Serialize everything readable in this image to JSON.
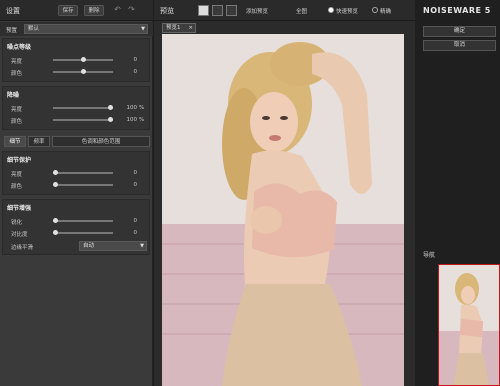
{
  "left_panel": {
    "title": "设置",
    "save_label": "保存",
    "delete_label": "删除",
    "undo_icon": "undo-icon",
    "redo_icon": "redo-icon",
    "preset": {
      "label": "预置",
      "value": "默认"
    },
    "noise_level": {
      "title": "噪点等级",
      "rows": [
        {
          "label": "亮度",
          "value": "0",
          "level": 0.5
        },
        {
          "label": "颜色",
          "value": "0",
          "level": 0.5
        }
      ]
    },
    "noise_reduction": {
      "title": "降噪",
      "rows": [
        {
          "label": "亮度",
          "value": "100",
          "unit": "%",
          "level": 1.0
        },
        {
          "label": "颜色",
          "value": "100",
          "unit": "%",
          "level": 1.0
        }
      ]
    },
    "tabs": [
      {
        "label": "细节",
        "active": true
      },
      {
        "label": "频率",
        "active": false
      },
      {
        "label": "色调和颜色范围",
        "active": false
      }
    ],
    "detail_protection": {
      "title": "细节保护",
      "rows": [
        {
          "label": "亮度",
          "value": "0",
          "level": 0.0
        },
        {
          "label": "颜色",
          "value": "0",
          "level": 0.0
        }
      ]
    },
    "detail_enhance": {
      "title": "细节增强",
      "rows": [
        {
          "label": "锐化",
          "value": "0",
          "level": 0.0
        },
        {
          "label": "对比度",
          "value": "0",
          "level": 0.0
        }
      ],
      "edge_label": "边缘平滑",
      "edge_value": "自动"
    }
  },
  "center": {
    "title": "预览",
    "add_label": "添加预览",
    "before_label": "全图",
    "fast_label": "快速预览",
    "accurate_label": "精确",
    "preview_tab": "预览1"
  },
  "right_panel": {
    "logo": "NOISEWARE 5",
    "ok_label": "确定",
    "cancel_label": "取消",
    "nav_title": "导航"
  },
  "colors": {
    "nav_frame": "#c01818"
  }
}
